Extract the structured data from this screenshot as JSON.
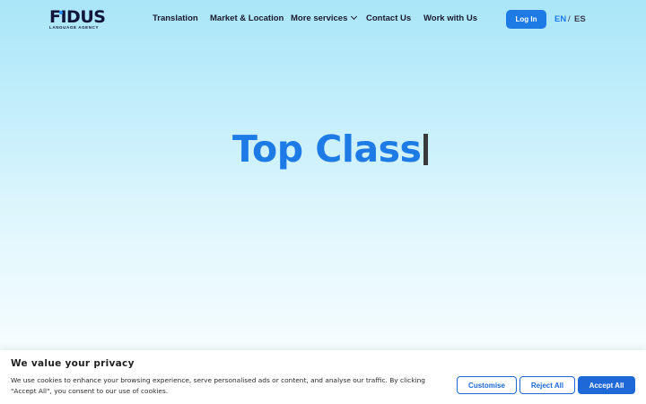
{
  "header": {
    "logo": {
      "word": "FIDUS",
      "tagline": "LANGUAGE AGENCY"
    },
    "nav": {
      "translation": "Translation",
      "market_location": "Market & Location",
      "more_services": "More services",
      "contact_us": "Contact Us",
      "work_with_us": "Work with Us"
    },
    "login_label": "Log In",
    "languages": {
      "en": "EN",
      "separator": "/",
      "es": "ES",
      "active": "EN"
    }
  },
  "hero": {
    "typed_text": "Top Class"
  },
  "cookie_banner": {
    "title": "We value your privacy",
    "text": "We use cookies to enhance your browsing experience, serve personalised ads or content, and analyse our traffic. By clicking \"Accept All\", you consent to our use of cookies.",
    "customise_label": "Customise",
    "reject_label": "Reject All",
    "accept_label": "Accept All"
  },
  "colors": {
    "accent": "#1e7be6",
    "cookie_button": "#1e68d8",
    "text_dark": "#1a1a2e"
  },
  "icons": {
    "more_services_dropdown": "chevron-down-icon"
  }
}
